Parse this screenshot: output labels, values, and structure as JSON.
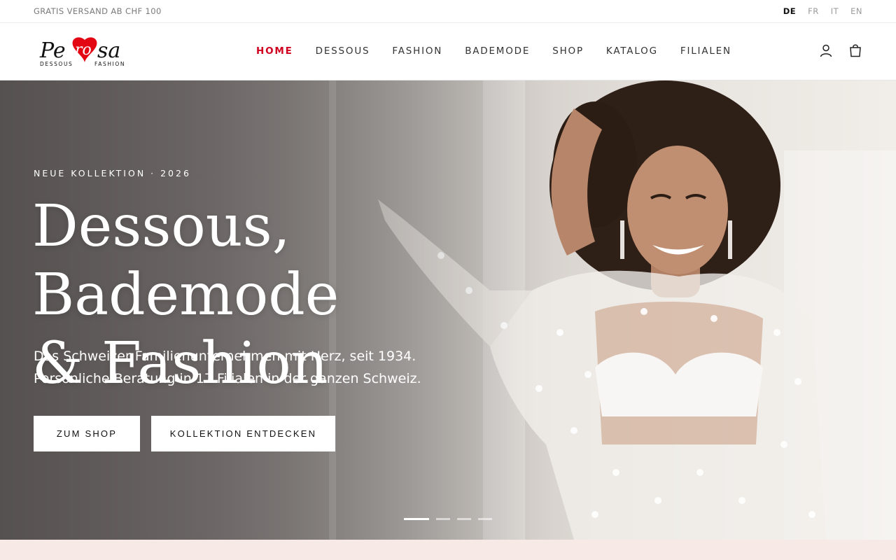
{
  "topbar": {
    "promo": "GRATIS VERSAND AB CHF 100",
    "languages": [
      {
        "label": "DE",
        "active": true
      },
      {
        "label": "FR",
        "active": false
      },
      {
        "label": "IT",
        "active": false
      },
      {
        "label": "EN",
        "active": false
      }
    ]
  },
  "header": {
    "logo": {
      "name": "Perosa",
      "tagline": "DESSOUS FASHION"
    },
    "nav": [
      {
        "label": "HOME",
        "active": true
      },
      {
        "label": "DESSOUS",
        "active": false
      },
      {
        "label": "FASHION",
        "active": false
      },
      {
        "label": "BADEMODE",
        "active": false
      },
      {
        "label": "SHOP",
        "active": false
      },
      {
        "label": "KATALOG",
        "active": false
      },
      {
        "label": "FILIALEN",
        "active": false
      }
    ],
    "icons": [
      "account-icon",
      "bag-icon"
    ]
  },
  "hero": {
    "eyebrow": "NEUE KOLLEKTION · 2026",
    "headline_line1": "Dessous, Bademode",
    "headline_line2": "& Fashion",
    "sub_line1": "Das Schweizer Familienunternehmen mit Herz, seit 1934.",
    "sub_line2": "Persönliche Beratung in 17 Filialen in der ganzen Schweiz.",
    "cta_primary": "ZUM SHOP",
    "cta_secondary": "KOLLEKTION ENTDECKEN",
    "slides_count": 4,
    "active_slide": 1
  },
  "colors": {
    "accent": "#d1001f",
    "logo_heart": "#e30613",
    "bottom_band": "#f7e9e6"
  }
}
